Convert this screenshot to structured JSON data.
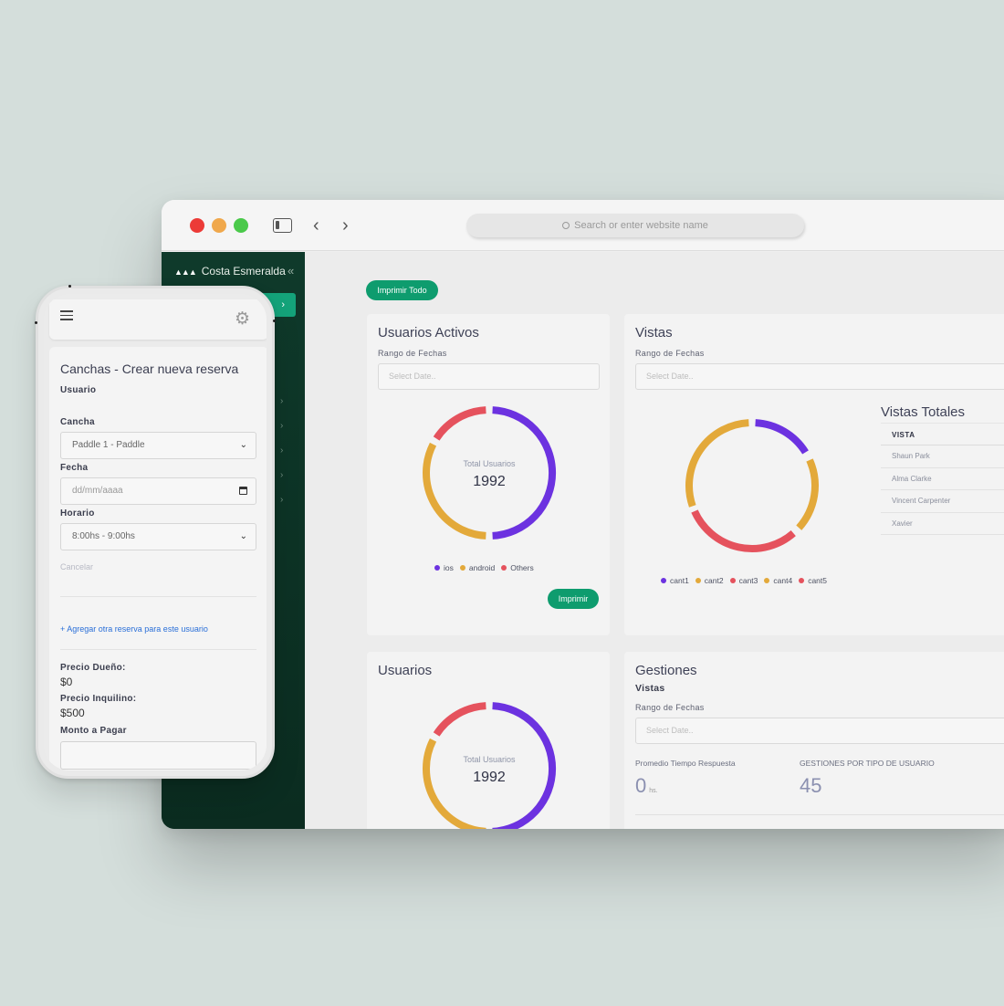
{
  "browser": {
    "url_placeholder": "Search or enter website name",
    "sidebar_toggle_icon": "sidebar-icon",
    "back_icon": "‹",
    "forward_icon": "›"
  },
  "sidebar": {
    "brand": "Costa Esmeralda",
    "logo": "▲▲▲",
    "collapse_icon": "«",
    "active_arrow": "›"
  },
  "toolbar": {
    "print_all": "Imprimir Todo"
  },
  "usuarios_activos": {
    "title": "Usuarios Activos",
    "range_label": "Rango de Fechas",
    "date_placeholder": "Select Date..",
    "center_label": "Total Usuarios",
    "center_value": "1992",
    "print_label": "Imprimir",
    "legend": [
      {
        "label": "ios",
        "color": "#6c32e0"
      },
      {
        "label": "android",
        "color": "#e3a93a"
      },
      {
        "label": "Others",
        "color": "#e5525d"
      }
    ]
  },
  "vistas": {
    "title": "Vistas",
    "range_label": "Rango de Fechas",
    "date_placeholder": "Select Date..",
    "legend": [
      {
        "label": "cant1",
        "color": "#6c32e0"
      },
      {
        "label": "cant2",
        "color": "#e3a93a"
      },
      {
        "label": "cant3",
        "color": "#e5525d"
      },
      {
        "label": "cant4",
        "color": "#e3a93a"
      },
      {
        "label": "cant5",
        "color": "#e5525d"
      }
    ],
    "totales_title": "Vistas Totales",
    "table_header": "VISTA",
    "table_rows": [
      "Shaun Park",
      "Alma Clarke",
      "Vincent Carpenter",
      "Xavier"
    ]
  },
  "usuarios": {
    "title": "Usuarios",
    "center_label": "Total Usuarios",
    "center_value": "1992"
  },
  "gestiones": {
    "title": "Gestiones",
    "subtitle": "Vistas",
    "range_label": "Rango de Fechas",
    "date_placeholder": "Select Date..",
    "stat1_label": "Promedio Tiempo Respuesta",
    "stat1_value": "0",
    "stat1_unit": "hs.",
    "stat2_label": "GESTIONES POR TIPO DE USUARIO",
    "stat2_value": "45"
  },
  "phone": {
    "gear_icon": "⚙",
    "form_title": "Canchas - Crear nueva reserva",
    "usuario_label": "Usuario",
    "cancha_label": "Cancha",
    "cancha_value": "Paddle 1 - Paddle",
    "fecha_label": "Fecha",
    "fecha_placeholder": "dd/mm/aaaa",
    "horario_label": "Horario",
    "horario_value": "8:00hs - 9:00hs",
    "cancel_label": "Cancelar",
    "add_link": "+ Agregar otra reserva para este usuario",
    "precio_dueno_label": "Precio Dueño:",
    "precio_dueno_value": "$0",
    "precio_inquilino_label": "Precio Inquilino:",
    "precio_inquilino_value": "$500",
    "monto_label": "Monto a Pagar",
    "chevron": "⌄"
  }
}
